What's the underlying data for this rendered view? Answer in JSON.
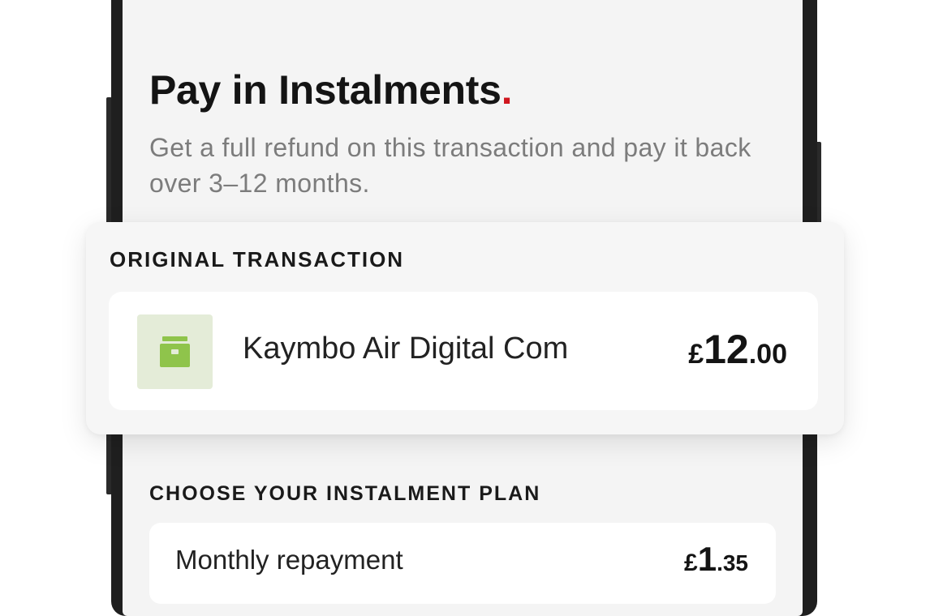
{
  "header": {
    "title": "Pay in Instalments",
    "title_dot": ".",
    "subtitle": "Get a full refund on this transaction and pay it back over 3–12 months."
  },
  "original_transaction": {
    "section_label": "ORIGINAL TRANSACTION",
    "merchant": "Kaymbo Air Digital Com",
    "merchant_icon": "wallet-icon",
    "amount": {
      "currency": "£",
      "whole": "12",
      "fraction": ".00"
    }
  },
  "instalment_plan": {
    "section_label": "CHOOSE YOUR INSTALMENT PLAN",
    "item_label": "Monthly repayment",
    "amount": {
      "currency": "£",
      "whole": "1",
      "fraction": ".35"
    }
  },
  "colors": {
    "accent_dot": "#d0161e",
    "merchant_icon_bg": "#e4ecd8",
    "merchant_icon_fg": "#8fc44b"
  }
}
